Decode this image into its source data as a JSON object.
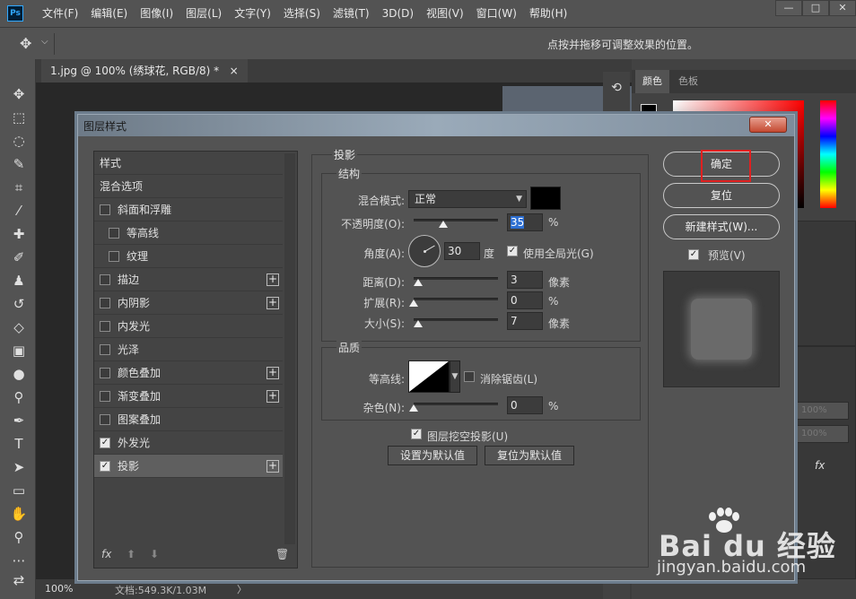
{
  "app": {
    "logo": "Ps",
    "menu": [
      "文件(F)",
      "编辑(E)",
      "图像(I)",
      "图层(L)",
      "文字(Y)",
      "选择(S)",
      "滤镜(T)",
      "3D(D)",
      "视图(V)",
      "窗口(W)",
      "帮助(H)"
    ],
    "window_controls": [
      "—",
      "□",
      "✕"
    ]
  },
  "options_bar": {
    "hint": "点按并拖移可调整效果的位置。"
  },
  "document": {
    "tab_title": "1.jpg @ 100% (绣球花, RGB/8) *",
    "tab_close": "×",
    "status_zoom": "100%",
    "status_doc": "文档:549.3K/1.03M",
    "status_arrow": "〉"
  },
  "right_panel": {
    "tabs": [
      "颜色",
      "色板"
    ],
    "fields": [
      "100%",
      "100%"
    ],
    "fx": "fx"
  },
  "dialog": {
    "title": "图层样式",
    "close": "✕",
    "style_list": [
      {
        "label": "样式",
        "checkbox": false,
        "checked": false,
        "plus": false,
        "indent": 0
      },
      {
        "label": "混合选项",
        "checkbox": false,
        "checked": false,
        "plus": false,
        "indent": 0
      },
      {
        "label": "斜面和浮雕",
        "checkbox": true,
        "checked": false,
        "plus": false,
        "indent": 0
      },
      {
        "label": "等高线",
        "checkbox": true,
        "checked": false,
        "plus": false,
        "indent": 1
      },
      {
        "label": "纹理",
        "checkbox": true,
        "checked": false,
        "plus": false,
        "indent": 1
      },
      {
        "label": "描边",
        "checkbox": true,
        "checked": false,
        "plus": true,
        "indent": 0
      },
      {
        "label": "内阴影",
        "checkbox": true,
        "checked": false,
        "plus": true,
        "indent": 0
      },
      {
        "label": "内发光",
        "checkbox": true,
        "checked": false,
        "plus": false,
        "indent": 0
      },
      {
        "label": "光泽",
        "checkbox": true,
        "checked": false,
        "plus": false,
        "indent": 0
      },
      {
        "label": "颜色叠加",
        "checkbox": true,
        "checked": false,
        "plus": true,
        "indent": 0
      },
      {
        "label": "渐变叠加",
        "checkbox": true,
        "checked": false,
        "plus": true,
        "indent": 0
      },
      {
        "label": "图案叠加",
        "checkbox": true,
        "checked": false,
        "plus": false,
        "indent": 0
      },
      {
        "label": "外发光",
        "checkbox": true,
        "checked": true,
        "plus": false,
        "indent": 0
      },
      {
        "label": "投影",
        "checkbox": true,
        "checked": true,
        "plus": true,
        "indent": 0,
        "selected": true
      }
    ],
    "list_footer": {
      "fx": "fx",
      "up": "⬆",
      "down": "⬇",
      "trash": "🗑"
    },
    "section_title": "投影",
    "structure": {
      "title": "结构",
      "blend_mode_label": "混合模式:",
      "blend_mode_value": "正常",
      "blend_color": "#000000",
      "opacity_label": "不透明度(O):",
      "opacity_value": "35",
      "opacity_unit": "%",
      "opacity_level": 0.35,
      "angle_label": "角度(A):",
      "angle_value": "30",
      "angle_unit": "度",
      "global_light_label": "使用全局光(G)",
      "global_light_checked": true,
      "distance_label": "距离(D):",
      "distance_value": "3",
      "distance_unit": "像素",
      "spread_label": "扩展(R):",
      "spread_value": "0",
      "spread_unit": "%",
      "size_label": "大小(S):",
      "size_value": "7",
      "size_unit": "像素"
    },
    "quality": {
      "title": "品质",
      "contour_label": "等高线:",
      "antialias_label": "消除锯齿(L)",
      "antialias_checked": false,
      "noise_label": "杂色(N):",
      "noise_value": "0",
      "noise_unit": "%"
    },
    "knockout_label": "图层挖空投影(U)",
    "knockout_checked": true,
    "set_default": "设置为默认值",
    "reset_default": "复位为默认值",
    "ok": "确定",
    "reset": "复位",
    "new_style": "新建样式(W)...",
    "preview_label": "预览(V)",
    "preview_checked": true
  },
  "watermark": {
    "brand": "Bai du 经验",
    "url": "jingyan.baidu.com"
  },
  "colors": {
    "accent": "#31a8ff",
    "ok_highlight": "#e02020",
    "selection": "#2d6fd2"
  }
}
